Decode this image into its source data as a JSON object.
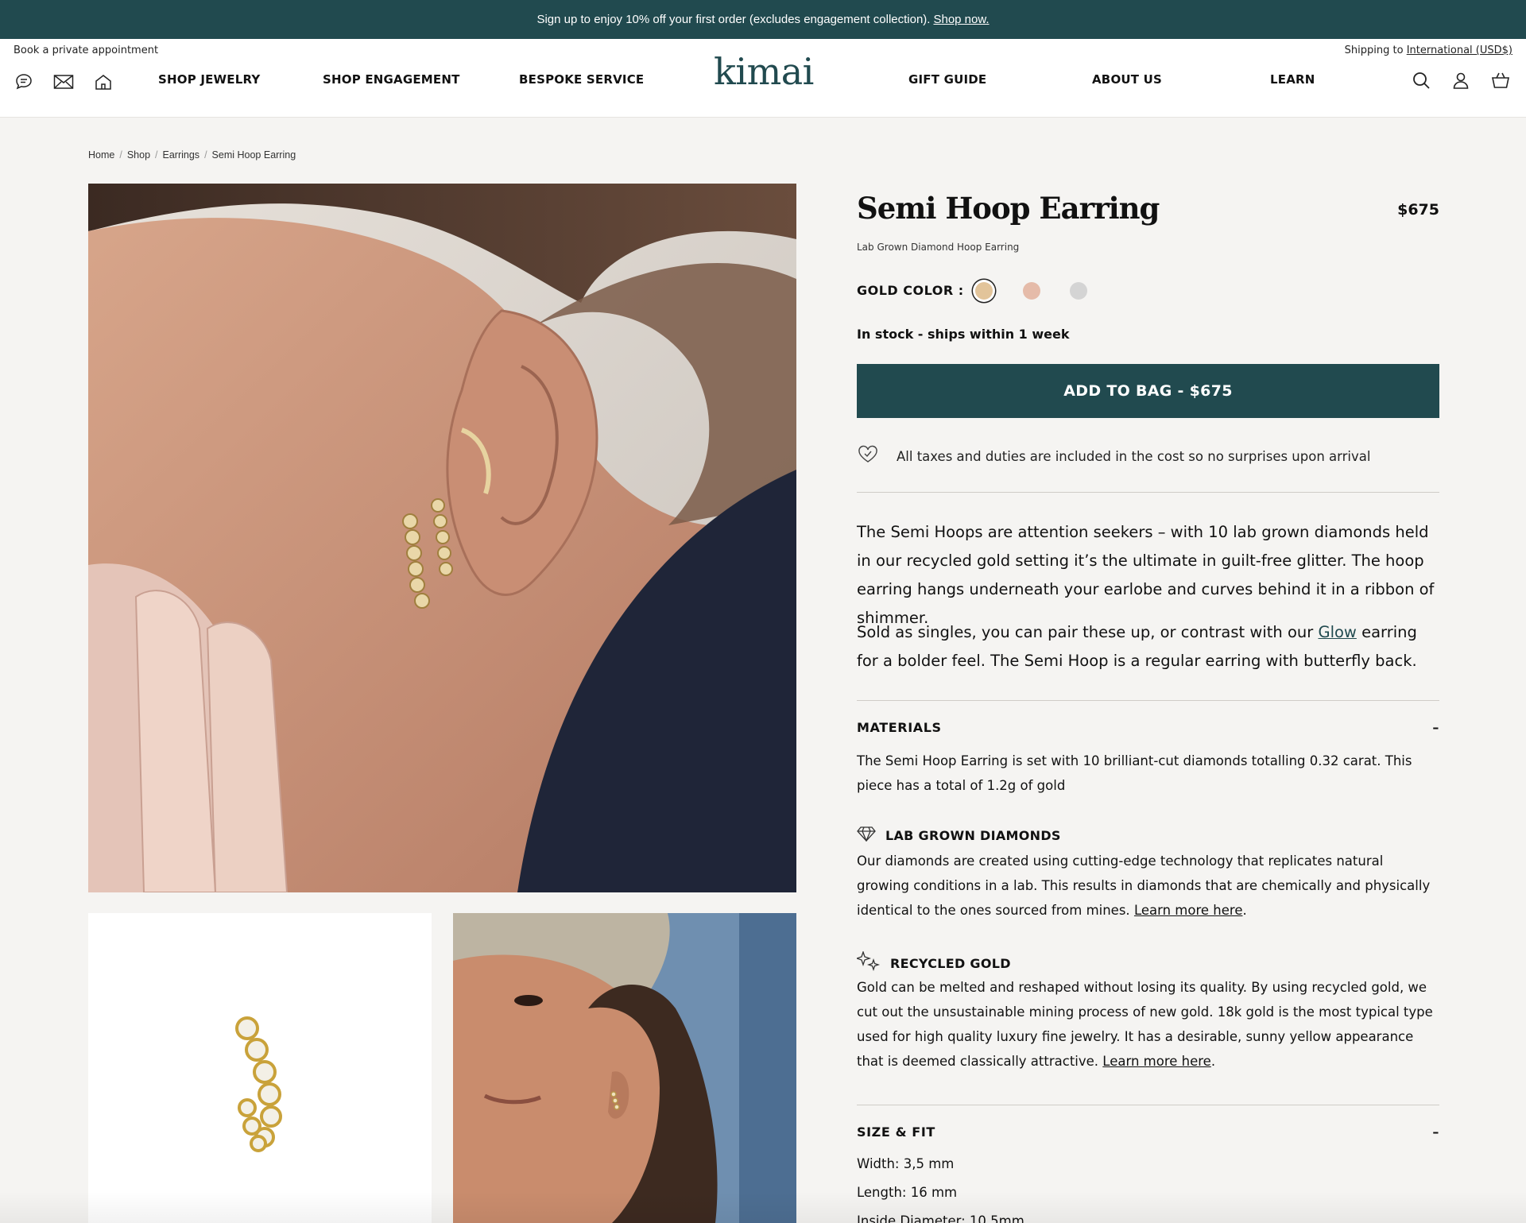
{
  "promo": {
    "text": "Sign up to enjoy 10% off your first order (excludes engagement collection).",
    "link": "Shop now."
  },
  "header": {
    "appointment": "Book a private appointment",
    "shipping_prefix": "Shipping to",
    "shipping_link": "International (USD$)",
    "logo": "kimai",
    "nav": [
      "SHOP JEWELRY",
      "SHOP ENGAGEMENT",
      "BESPOKE SERVICE",
      "GIFT GUIDE",
      "ABOUT US",
      "LEARN"
    ],
    "icons_left": [
      "chat-icon",
      "mail-icon",
      "home-icon"
    ],
    "icons_right": [
      "search-icon",
      "account-icon",
      "bag-icon"
    ]
  },
  "breadcrumb": [
    "Home",
    "Shop",
    "Earrings",
    "Semi Hoop Earring"
  ],
  "product": {
    "title": "Semi Hoop Earring",
    "price": "$675",
    "subtitle": "Lab Grown Diamond Hoop Earring",
    "gold_label": "GOLD COLOR :",
    "swatches": [
      {
        "name": "yellow-gold",
        "color": "#e2c49a",
        "selected": true
      },
      {
        "name": "rose-gold",
        "color": "#e5bba9",
        "selected": false
      },
      {
        "name": "white-gold",
        "color": "#d4d4d4",
        "selected": false
      }
    ],
    "stock": "In stock - ships within 1 week",
    "add_to_bag": "ADD TO BAG - $675",
    "taxes": "All taxes and duties are included in the cost so no surprises upon arrival",
    "desc1": "The Semi Hoops are attention seekers – with 10 lab grown diamonds held in our recycled gold setting it’s the ultimate in guilt-free glitter. The hoop earring hangs underneath your earlobe and curves behind it in a ribbon of shimmer.",
    "desc2_pre": "Sold as singles, you can pair these up, or contrast with our",
    "desc2_link": "Glow",
    "desc2_post": "earring for a bolder feel. The Semi Hoop is a regular earring with butterfly back."
  },
  "materials": {
    "heading": "MATERIALS",
    "toggle": "–",
    "text": "The Semi Hoop Earring is set with 10 brilliant-cut diamonds totalling 0.32 carat. This piece has a total of 1.2g of gold",
    "lab_heading": "LAB GROWN DIAMONDS",
    "lab_text": "Our diamonds are created using cutting-edge technology that replicates natural growing conditions in a lab. This results in diamonds that are chemically and physically identical to the ones sourced from mines.",
    "lab_link": "Learn more here",
    "gold_heading": "RECYCLED GOLD",
    "gold_text": "Gold can be melted and reshaped without losing its quality. By using recycled gold, we cut out the unsustainable mining process of new gold. 18k gold is the most typical type used for high quality luxury fine jewelry. It has a desirable, sunny yellow appearance that is deemed classically attractive.",
    "gold_link": "Learn more here"
  },
  "size": {
    "heading": "SIZE & FIT",
    "toggle": "–",
    "width": "Width: 3,5 mm",
    "length": "Length: 16 mm",
    "inside": "Inside Diameter: 10,5mm"
  }
}
